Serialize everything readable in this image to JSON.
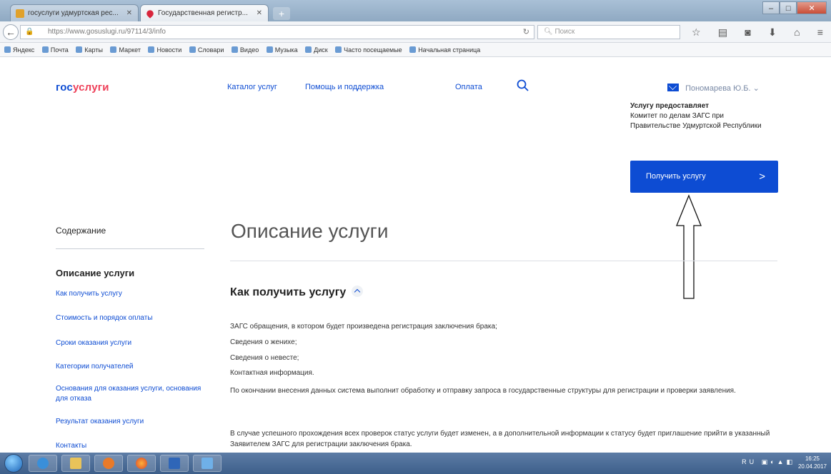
{
  "browser": {
    "tabs": [
      {
        "label": "госуслуги удмуртская рес..."
      },
      {
        "label": "Государственная регистр..."
      }
    ],
    "url": "https://www.gosuslugi.ru/97114/3/info",
    "search_placeholder": "Поиск",
    "bookmarks": [
      "Яндекс",
      "Почта",
      "Карты",
      "Маркет",
      "Новости",
      "Словари",
      "Видео",
      "Музыка",
      "Диск",
      "Часто посещаемые",
      "Начальная страница"
    ]
  },
  "site": {
    "logo_part1": "гос",
    "logo_part2": "услуги",
    "nav": [
      "Каталог услуг",
      "Помощь и поддержка",
      "Оплата"
    ],
    "user_name": "Пономарева Ю.Б."
  },
  "provider": {
    "heading": "Услугу предоставляет",
    "text": "Комитет по делам ЗАГС при Правительстве Удмуртской Республики"
  },
  "get_service_button": "Получить услугу",
  "leftnav": {
    "title": "Содержание",
    "current": "Описание услуги",
    "links": [
      "Как получить услугу",
      "Стоимость и порядок оплаты",
      "Сроки оказания услуги",
      "Категории получателей",
      "Основания для оказания услуги, основания для отказа",
      "Результат оказания услуги",
      "Контакты"
    ]
  },
  "main": {
    "title": "Описание услуги",
    "section_title": "Как получить услугу",
    "paragraphs": [
      "ЗАГС обращения, в котором будет произведена регистрация заключения брака;",
      "Сведения о жениxе;",
      "Сведения о невесте;",
      "Контактная информация.",
      "По окончании внесения данных система выполнит обработку и отправку запроса в государственные структуры для регистрации и проверки заявления.",
      "В случае успешного прохождения всех проверок статус услуги будет изменен, а в дополнительной информации к статусу будет приглашение прийти в указанный Заявителем ЗАГС для регистрации заключения брака."
    ]
  },
  "taskbar": {
    "tray_lang": "RU",
    "time": "16:25",
    "date": "20.04.2017"
  }
}
